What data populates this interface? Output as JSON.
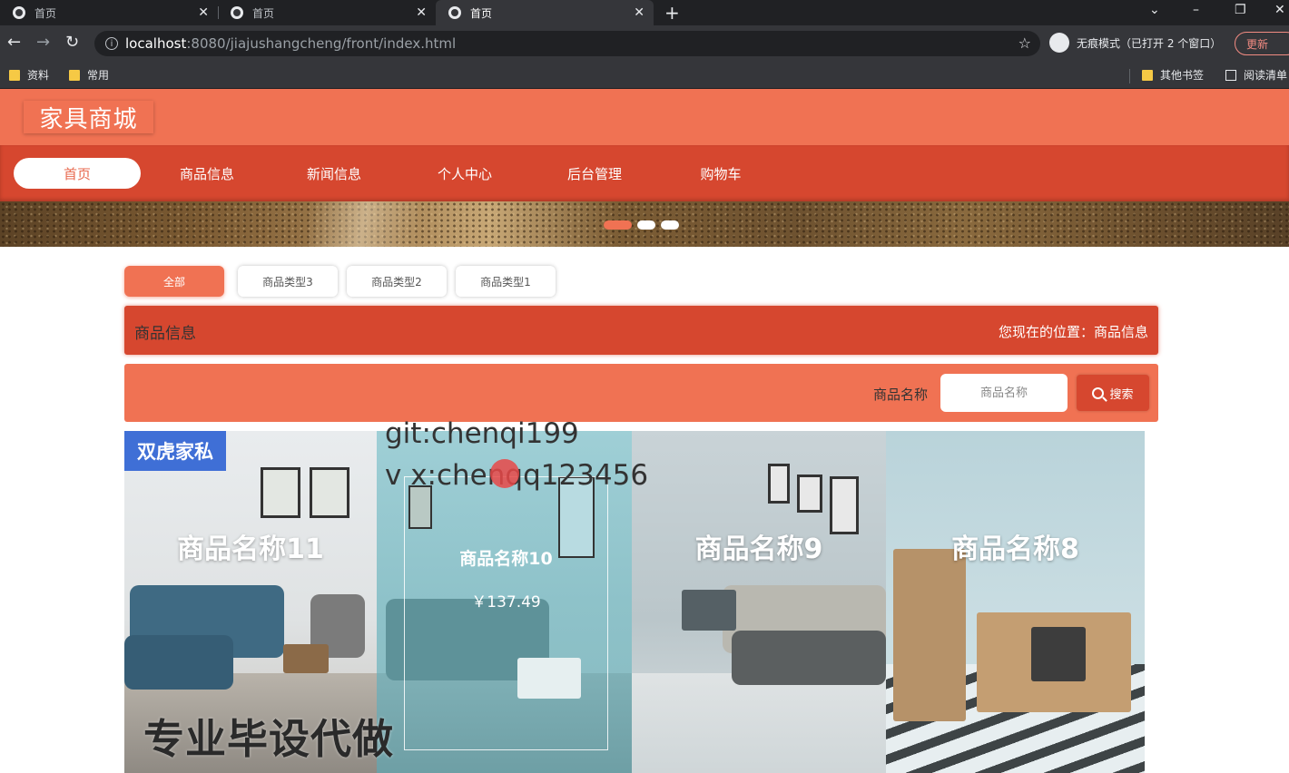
{
  "browser": {
    "tabs": [
      {
        "title": "首页",
        "active": false
      },
      {
        "title": "首页",
        "active": false
      },
      {
        "title": "首页",
        "active": true
      }
    ],
    "url_host": "localhost",
    "url_path": ":8080/jiajushangcheng/front/index.html",
    "incognito_text": "无痕模式（已打开 2 个窗口）",
    "update_label": "更新",
    "bookmarks": [
      "资料",
      "常用"
    ],
    "bookmarks_right": [
      "其他书签",
      "阅读清单"
    ]
  },
  "site": {
    "logo": "家具商城",
    "nav": [
      {
        "label": "首页",
        "active": true
      },
      {
        "label": "商品信息",
        "active": false
      },
      {
        "label": "新闻信息",
        "active": false
      },
      {
        "label": "个人中心",
        "active": false
      },
      {
        "label": "后台管理",
        "active": false
      },
      {
        "label": "购物车",
        "active": false
      }
    ],
    "carousel_active_index": 0,
    "categories": [
      {
        "label": "全部",
        "active": true
      },
      {
        "label": "商品类型3",
        "active": false
      },
      {
        "label": "商品类型2",
        "active": false
      },
      {
        "label": "商品类型1",
        "active": false
      }
    ],
    "section_title": "商品信息",
    "breadcrumb": "您现在的位置：商品信息",
    "search": {
      "label": "商品名称",
      "placeholder": "商品名称",
      "button_label": "搜索"
    },
    "products": [
      {
        "name": "商品名称11",
        "brand_badge": "双虎家私"
      },
      {
        "name": "商品名称10",
        "price": "￥137.49",
        "hovered": true
      },
      {
        "name": "商品名称9"
      },
      {
        "name": "商品名称8"
      }
    ]
  },
  "watermarks": {
    "line1": "git:chenqi199",
    "line2": "v x:chenqq123456",
    "big": "专业毕设代做"
  },
  "colors": {
    "header": "#f07253",
    "nav": "#d6472f",
    "accent": "#f07253"
  }
}
